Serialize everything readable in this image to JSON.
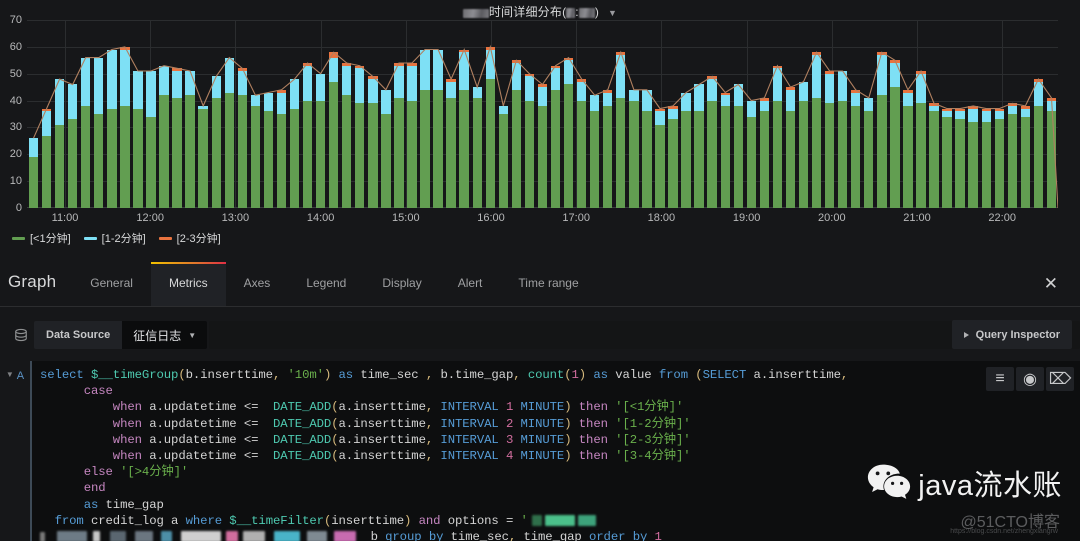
{
  "panel": {
    "title_suffix": "时间详细分布",
    "title_tail": ")",
    "caret_icon": "chevron-down-icon"
  },
  "chart_data": {
    "type": "bar",
    "stacked": true,
    "title": "时间详细分布",
    "xlabel": "",
    "ylabel": "",
    "ylim": [
      0,
      70
    ],
    "yticks": [
      0,
      10,
      20,
      30,
      40,
      50,
      60,
      70
    ],
    "grid": true,
    "legend_position": "bottom-left",
    "xtick_labels": [
      "11:00",
      "12:00",
      "13:00",
      "14:00",
      "15:00",
      "16:00",
      "17:00",
      "18:00",
      "19:00",
      "20:00",
      "21:00",
      "22:00"
    ],
    "interval": "10m",
    "series": [
      {
        "name": "[<1分钟]",
        "color": "#629e51",
        "values": [
          19,
          27,
          31,
          33,
          38,
          35,
          37,
          38,
          37,
          34,
          42,
          41,
          42,
          37,
          41,
          43,
          42,
          38,
          36,
          35,
          37,
          40,
          40,
          47,
          42,
          39,
          39,
          35,
          41,
          40,
          44,
          44,
          41,
          44,
          41,
          48,
          35,
          44,
          40,
          38,
          44,
          46,
          40,
          36,
          38,
          41,
          40,
          36,
          31,
          33,
          36,
          36,
          40,
          38,
          38,
          34,
          36,
          40,
          36,
          40,
          41,
          39,
          40,
          38,
          36,
          42,
          45,
          38,
          39,
          36,
          34,
          33,
          32,
          32,
          33,
          35,
          34,
          38,
          36
        ]
      },
      {
        "name": "[1-2分钟]",
        "color": "#7ee0f5",
        "values": [
          7,
          9,
          17,
          13,
          18,
          21,
          22,
          21,
          14,
          17,
          11,
          10,
          9,
          1,
          8,
          13,
          9,
          4,
          7,
          8,
          11,
          13,
          10,
          9,
          11,
          13,
          9,
          9,
          12,
          13,
          15,
          15,
          6,
          14,
          4,
          11,
          3,
          10,
          9,
          7,
          8,
          9,
          7,
          6,
          5,
          16,
          4,
          8,
          5,
          4,
          7,
          10,
          8,
          4,
          8,
          6,
          4,
          12,
          8,
          7,
          16,
          11,
          11,
          5,
          5,
          15,
          9,
          5,
          11,
          2,
          2,
          3,
          5,
          4,
          3,
          3,
          3,
          9,
          4
        ]
      },
      {
        "name": "[2-3分钟]",
        "color": "#e8733f",
        "values": [
          0,
          1,
          0,
          0,
          0,
          0,
          0,
          1,
          0,
          0,
          0,
          1,
          0,
          0,
          0,
          0,
          1,
          0,
          0,
          1,
          0,
          1,
          0,
          2,
          1,
          1,
          1,
          0,
          1,
          1,
          0,
          0,
          1,
          1,
          0,
          1,
          0,
          1,
          1,
          1,
          1,
          1,
          1,
          0,
          1,
          1,
          0,
          0,
          1,
          1,
          0,
          0,
          1,
          1,
          0,
          0,
          1,
          1,
          1,
          0,
          1,
          1,
          0,
          1,
          0,
          1,
          1,
          1,
          1,
          1,
          1,
          1,
          1,
          1,
          1,
          1,
          1,
          1,
          1
        ]
      }
    ],
    "legend": [
      {
        "label": "[<1分钟]",
        "color": "#629e51"
      },
      {
        "label": "[1-2分钟]",
        "color": "#7ee0f5"
      },
      {
        "label": "[2-3分钟]",
        "color": "#e8733f"
      }
    ]
  },
  "editor": {
    "title": "Graph",
    "close_icon": "close-icon",
    "tabs": [
      {
        "label": "General",
        "active": false
      },
      {
        "label": "Metrics",
        "active": true
      },
      {
        "label": "Axes",
        "active": false
      },
      {
        "label": "Legend",
        "active": false
      },
      {
        "label": "Display",
        "active": false
      },
      {
        "label": "Alert",
        "active": false
      },
      {
        "label": "Time range",
        "active": false
      }
    ],
    "datasource": {
      "icon": "database-icon",
      "label": "Data Source",
      "value": "征信日志",
      "caret_icon": "chevron-down-icon"
    },
    "query_inspector": {
      "label": "Query Inspector",
      "icon": "triangle-right-icon"
    },
    "query": {
      "ref_id": "A",
      "collapse_icon": "chevron-down-icon",
      "tools": [
        {
          "icon": "hamburger-icon",
          "glyph": "≡"
        },
        {
          "icon": "eye-icon",
          "glyph": "◉"
        },
        {
          "icon": "trash-icon",
          "glyph": "⌦"
        }
      ],
      "lines": [
        "select $__timeGroup(b.inserttime, '10m') as time_sec , b.time_gap, count(1) as value from (SELECT a.inserttime,",
        "      case",
        "          when a.updatetime <=  DATE_ADD(a.inserttime, INTERVAL 1 MINUTE) then '[<1分钟]'",
        "          when a.updatetime <=  DATE_ADD(a.inserttime, INTERVAL 2 MINUTE) then '[1-2分钟]'",
        "          when a.updatetime <=  DATE_ADD(a.inserttime, INTERVAL 3 MINUTE) then '[2-3分钟]'",
        "          when a.updatetime <=  DATE_ADD(a.inserttime, INTERVAL 4 MINUTE) then '[3-4分钟]'",
        "      else '[>4分钟]'",
        "      end",
        "      as time_gap",
        "  from credit_log a where $__timeFilter(inserttime) and options = '",
        "  b group by time_sec, time_gap order by 1"
      ]
    }
  },
  "watermark": {
    "icon": "wechat-icon",
    "text": "java流水账",
    "credit": "@51CTO博客",
    "url": "https://blog.csdn.net/zhengxiangrw"
  }
}
